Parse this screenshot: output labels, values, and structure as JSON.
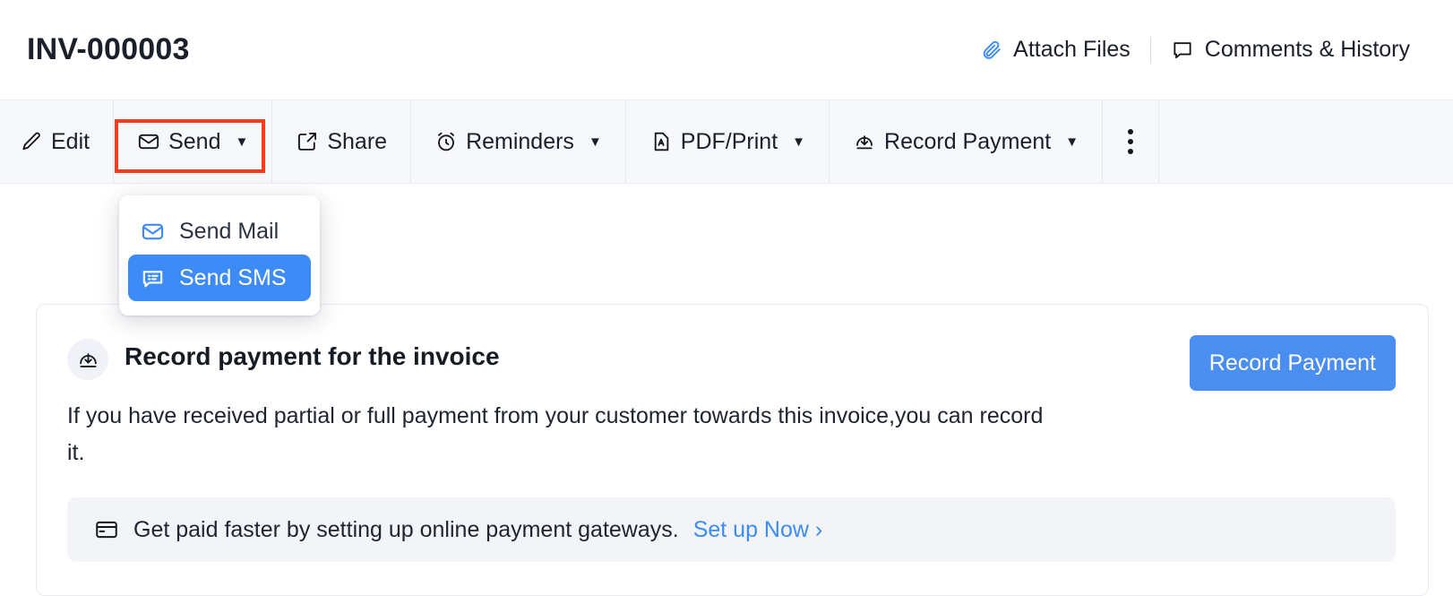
{
  "header": {
    "title": "INV-000003",
    "actions": [
      {
        "label": "Attach Files",
        "icon": "paperclip-icon"
      },
      {
        "label": "Comments & History",
        "icon": "comment-bubble-icon"
      }
    ]
  },
  "toolbar": {
    "buttons": [
      {
        "label": "Edit",
        "icon": "pencil-icon",
        "caret": ""
      },
      {
        "label": "Send",
        "icon": "envelope-icon",
        "caret": "▼"
      },
      {
        "label": "Share",
        "icon": "share-icon",
        "caret": ""
      },
      {
        "label": "Reminders",
        "icon": "alarm-clock-icon",
        "caret": "▼"
      },
      {
        "label": "PDF/Print",
        "icon": "pdf-file-icon",
        "caret": "▼"
      },
      {
        "label": "Record Payment",
        "icon": "download-circle-icon",
        "caret": "▼"
      }
    ],
    "more_menu": {
      "icon": "kebab-menu-icon"
    },
    "highlight_color": "#fc3b1d"
  },
  "send_dropdown": {
    "items": [
      {
        "label": "Send Mail",
        "icon": "envelope-outline-icon",
        "active": false
      },
      {
        "label": "Send SMS",
        "icon": "sms-bubble-icon",
        "active": true
      }
    ],
    "active_color": "#3d8bf7"
  },
  "card": {
    "badge_icon": "download-circle-icon",
    "title": "Record payment for the invoice",
    "body": "If you have received partial or full payment from your customer towards this invoice,you can record it.",
    "primary_button": {
      "label": "Record Payment",
      "color": "#4a8ef0"
    },
    "banner": {
      "icon": "credit-card-icon",
      "text": "Get paid faster by setting up online payment gateways.",
      "link": "Set up Now ›",
      "link_color": "#3b8cf5"
    }
  }
}
